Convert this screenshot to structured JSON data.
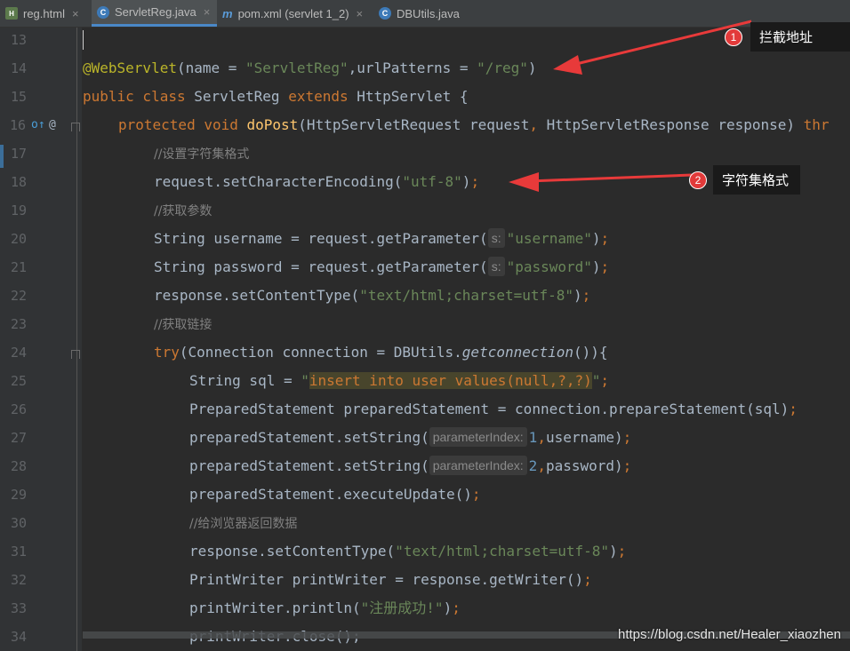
{
  "tabs": [
    {
      "label": "reg.html",
      "icon": "html-file-icon",
      "active": false
    },
    {
      "label": "ServletReg.java",
      "icon": "java-class-icon",
      "active": true
    },
    {
      "label": "pom.xml (servlet 1_2)",
      "icon": "maven-icon",
      "active": false
    },
    {
      "label": "DBUtils.java",
      "icon": "java-class-icon",
      "active": false
    }
  ],
  "tab_close_glyph": "×",
  "tab_icon_glyphs": {
    "html": "H",
    "java": "C",
    "pom": "m",
    "dbu": "C"
  },
  "line_numbers": [
    "13",
    "14",
    "15",
    "16",
    "17",
    "18",
    "19",
    "20",
    "21",
    "22",
    "23",
    "24",
    "25",
    "26",
    "27",
    "28",
    "29",
    "30",
    "31",
    "32",
    "33",
    "34"
  ],
  "gutter_marks": {
    "override": "o↑",
    "annotation": "@"
  },
  "code": {
    "l14_ann": "@WebServlet",
    "l14_a": "(name = ",
    "l14_s1": "\"ServletReg\"",
    "l14_b": ",urlPatterns = ",
    "l14_s2": "\"/reg\"",
    "l14_c": ")",
    "l15_kw1": "public class ",
    "l15_a": "ServletReg ",
    "l15_kw2": "extends ",
    "l15_b": "HttpServlet {",
    "l16_kw": "protected void ",
    "l16_fn": "doPost",
    "l16_a": "(HttpServletRequest request",
    "l16_comma": ", ",
    "l16_b": "HttpServletResponse response) ",
    "l16_kw2": "thr",
    "l17_cmt": "//设置字符集格式",
    "l18_a": "request.setCharacterEncoding(",
    "l18_s": "\"utf-8\"",
    "l18_b": ")",
    "l18_semi": ";",
    "l19_cmt": "//获取参数",
    "l20_a": "String username = request.getParameter(",
    "l20_hint": "s:",
    "l20_s": "\"username\"",
    "l20_b": ")",
    "l20_semi": ";",
    "l21_a": "String password = request.getParameter(",
    "l21_hint": "s:",
    "l21_s": "\"password\"",
    "l21_b": ")",
    "l21_semi": ";",
    "l22_a": "response.setContentType(",
    "l22_s": "\"text/html;charset=utf-8\"",
    "l22_b": ")",
    "l22_semi": ";",
    "l23_cmt": "//获取链接",
    "l24_kw": "try",
    "l24_a": "(Connection connection = DBUtils.",
    "l24_it": "getconnection",
    "l24_b": "()){",
    "l25_a": "String sql = ",
    "l25_q1": "\"",
    "l25_inj": "insert into user values(null,?,?)",
    "l25_q2": "\"",
    "l25_semi": ";",
    "l26_a": "PreparedStatement preparedStatement = connection.prepareStatement(sql)",
    "l26_semi": ";",
    "l27_a": "preparedStatement.setString(",
    "l27_hint": "parameterIndex:",
    "l27_num": "1",
    "l27_comma": ",",
    "l27_b": "username)",
    "l27_semi": ";",
    "l28_a": "preparedStatement.setString(",
    "l28_hint": "parameterIndex:",
    "l28_num": "2",
    "l28_comma": ",",
    "l28_b": "password)",
    "l28_semi": ";",
    "l29_a": "preparedStatement.executeUpdate()",
    "l29_semi": ";",
    "l30_cmt": "//给浏览器返回数据",
    "l31_a": "response.setContentType(",
    "l31_s": "\"text/html;charset=utf-8\"",
    "l31_b": ")",
    "l31_semi": ";",
    "l32_a": "PrintWriter printWriter = response.getWriter()",
    "l32_semi": ";",
    "l33_a": "printWriter.println(",
    "l33_s": "\"注册成功!\"",
    "l33_b": ")",
    "l33_semi": ";",
    "l34_a": "printWriter.close();"
  },
  "annotations": [
    {
      "number": "1",
      "label": "拦截地址"
    },
    {
      "number": "2",
      "label": "字符集格式"
    }
  ],
  "colors": {
    "arrow": "#e83a3a",
    "editor_bg": "#2b2b2b",
    "keyword": "#cc7832",
    "string": "#6a8759",
    "annotation": "#bbb529"
  },
  "watermark": "https://blog.csdn.net/Healer_xiaozhen"
}
